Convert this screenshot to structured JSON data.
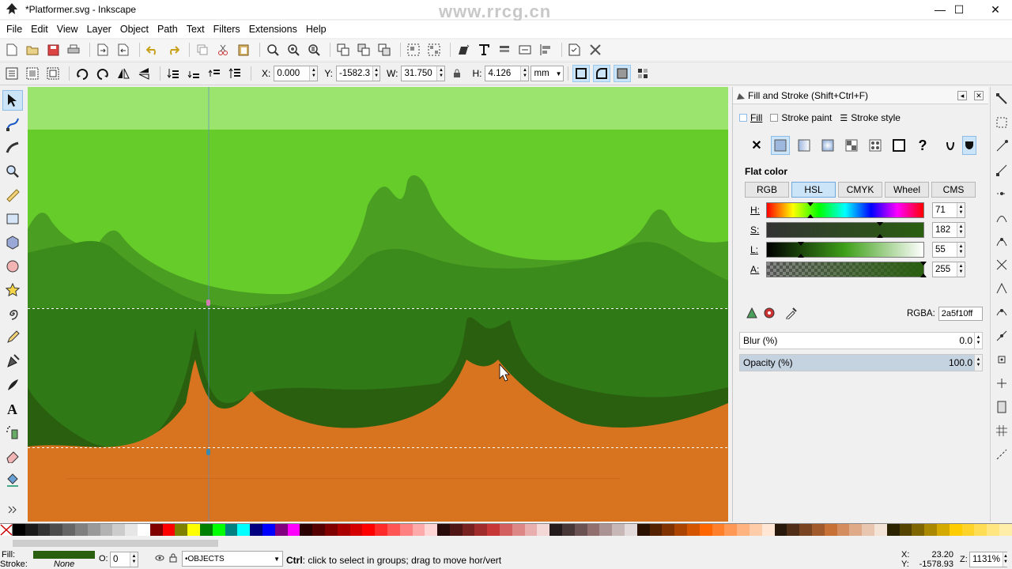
{
  "window": {
    "title": "*Platformer.svg - Inkscape",
    "watermark": "www.rrcg.cn",
    "minimize_glyph": "—",
    "maximize_glyph": "☐",
    "close_glyph": "✕"
  },
  "menu": [
    "File",
    "Edit",
    "View",
    "Layer",
    "Object",
    "Path",
    "Text",
    "Filters",
    "Extensions",
    "Help"
  ],
  "controls": {
    "x_label": "X:",
    "x_value": "0.000",
    "y_label": "Y:",
    "y_value": "-1582.3",
    "w_label": "W:",
    "w_value": "31.750",
    "h_label": "H:",
    "h_value": "4.126",
    "unit": "mm"
  },
  "dock": {
    "title": "Fill and Stroke (Shift+Ctrl+F)",
    "tabs": [
      "Fill",
      "Stroke paint",
      "Stroke style"
    ],
    "flat_color_label": "Flat color",
    "modes": [
      "RGB",
      "HSL",
      "CMYK",
      "Wheel",
      "CMS"
    ],
    "active_mode": "HSL",
    "sliders": [
      {
        "label": "H:",
        "value": "71"
      },
      {
        "label": "S:",
        "value": "182"
      },
      {
        "label": "L:",
        "value": "55"
      },
      {
        "label": "A:",
        "value": "255"
      }
    ],
    "rgba_label": "RGBA:",
    "rgba_value": "2a5f10ff",
    "blur_label": "Blur (%)",
    "blur_value": "0.0",
    "opacity_label": "Opacity (%)",
    "opacity_value": "100.0"
  },
  "colors": {
    "sky_light": "#9be56f",
    "grass_bright": "#66cc2a",
    "grass_mid": "#4a9e22",
    "grass_dark": "#3a8a1c",
    "grass_darkest": "#2a5f10",
    "ground": "#d8731f",
    "accent": "#cce4f7"
  },
  "status": {
    "fill_label": "Fill:",
    "stroke_label": "Stroke:",
    "stroke_value": "None",
    "opacity_label": "O:",
    "opacity_value": "0",
    "layer_value": "•OBJECTS",
    "message_bold": "Ctrl",
    "message": ": click to select in groups; drag to move hor/vert",
    "x_label": "X:",
    "x_value": "23.20",
    "y_label": "Y:",
    "y_value": "-1578.93",
    "zoom_label": "Z:",
    "zoom_value": "1131%"
  }
}
